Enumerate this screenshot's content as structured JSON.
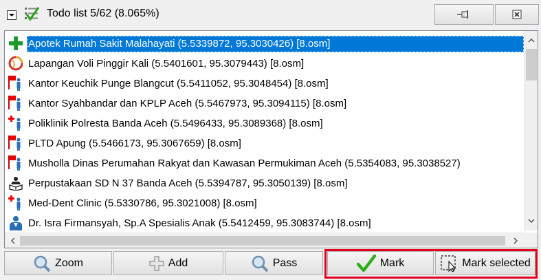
{
  "window": {
    "title": "Todo list 5/62 (8.065%)"
  },
  "titlebar_icons": {
    "collapse": "collapse-arrow-icon",
    "todo": "todo-checklist-icon",
    "pin": "pin-icon",
    "close": "close-icon"
  },
  "list": {
    "items": [
      {
        "label": "Apotek Rumah Sakit Malahayati (5.5339872, 95.3030426) [8.osm]",
        "icon": "pharmacy-cross-icon",
        "selected": true
      },
      {
        "label": "Lapangan Voli Pinggir Kali (5.5401601, 95.3079443) [8.osm]",
        "icon": "volleyball-icon",
        "selected": false
      },
      {
        "label": "Kantor Keuchik Punge Blangcut (5.5411052, 95.3048454) [8.osm]",
        "icon": "office-flag-icon",
        "selected": false
      },
      {
        "label": "Kantor Syahbandar dan KPLP Aceh (5.5467973, 95.3094115) [8.osm]",
        "icon": "office-flag-icon",
        "selected": false
      },
      {
        "label": "Poliklinik Polresta Banda Aceh (5.5496433, 95.3089368) [8.osm]",
        "icon": "clinic-icon",
        "selected": false
      },
      {
        "label": "PLTD Apung (5.5466173, 95.3067659) [8.osm]",
        "icon": "office-flag-icon",
        "selected": false
      },
      {
        "label": "Musholla Dinas Perumahan Rakyat dan Kawasan Permukiman Aceh (5.5354083, 95.3038527)",
        "icon": "office-flag-icon",
        "selected": false
      },
      {
        "label": "Perpustakaan SD N 37 Banda Aceh (5.5394787, 95.3050139) [8.osm]",
        "icon": "library-icon",
        "selected": false
      },
      {
        "label": "Med-Dent Clinic (5.5330786, 95.3021008) [8.osm]",
        "icon": "clinic-icon",
        "selected": false
      },
      {
        "label": "Dr. Isra Firmansyah, Sp.A Spesialis Anak (5.5412459, 95.3083744) [8.osm]",
        "icon": "doctor-icon",
        "selected": false
      }
    ]
  },
  "buttons": {
    "zoom": "Zoom",
    "add": "Add",
    "pass": "Pass",
    "mark": "Mark",
    "mark_selected": "Mark selected"
  },
  "button_icons": {
    "zoom": "zoom-magnifier-icon",
    "add": "add-plus-icon",
    "pass": "pass-magnifier-icon",
    "mark": "checkmark-icon",
    "mark_selected": "mark-selected-cursor-icon"
  },
  "colors": {
    "selection": "#0078d7",
    "highlight_box": "#e3001b"
  }
}
